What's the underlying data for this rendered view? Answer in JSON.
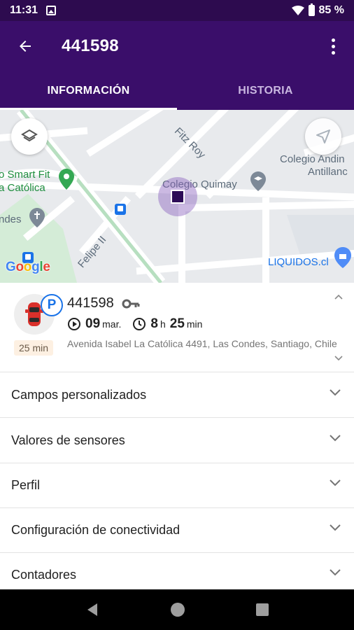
{
  "status_bar": {
    "time": "11:31",
    "battery": "85 %"
  },
  "app_bar": {
    "title": "441598"
  },
  "tabs": [
    {
      "label": "INFORMACIÓN",
      "active": true
    },
    {
      "label": "HISTORIA",
      "active": false
    }
  ],
  "map": {
    "labels": {
      "fitz_roy": "Fitz Roy",
      "colegio_andino": "Colegio Andin",
      "antillanca": "Antillanc",
      "smart_fit": "o Smart Fit",
      "la_catolica": "a Católica",
      "colegio_quimay": "Colegio Quimay",
      "condes": "ndes",
      "felipe": "Felipe II",
      "liquidos": "LIQUIDOS.cl"
    },
    "google_letters": [
      "G",
      "o",
      "o",
      "g",
      "l",
      "e"
    ],
    "google_colors": [
      "#4285F4",
      "#EA4335",
      "#FBBC05",
      "#4285F4",
      "#34A853",
      "#EA4335"
    ]
  },
  "info": {
    "unit_name": "441598",
    "parking_badge": "P",
    "duration_badge": "25 min",
    "day": "09",
    "month": "mar.",
    "hours": "8",
    "hours_unit": "h",
    "minutes": "25",
    "minutes_unit": "min",
    "address": "Avenida Isabel La Católica 4491, Las Condes, Santiago, Chile"
  },
  "sections": [
    {
      "label": "Campos personalizados"
    },
    {
      "label": "Valores de sensores"
    },
    {
      "label": "Perfil"
    },
    {
      "label": "Configuración de conectividad"
    },
    {
      "label": "Contadores"
    }
  ],
  "colors": {
    "primary": "#3a0e6a",
    "status": "#2d0b4f",
    "accent_blue": "#1a73e8",
    "marker": "#2c0b57"
  }
}
